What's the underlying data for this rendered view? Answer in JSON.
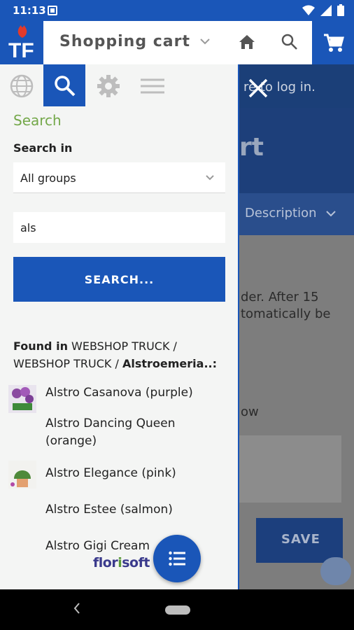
{
  "status_bar": {
    "time": "11:13"
  },
  "header": {
    "title": "Shopping cart"
  },
  "background_page": {
    "login_text": "re to log in.",
    "banner_text": "rt",
    "description_label": "Description",
    "text_line1": "der. After 15",
    "text_line2": "tomatically be",
    "text_line3": "ow",
    "save_label": "SAVE"
  },
  "drawer": {
    "section_title": "Search",
    "search_in_label": "Search in",
    "search_in_value": "All groups",
    "search_value": "als",
    "search_button": "SEARCH...",
    "found": {
      "prefix": "Found in",
      "path": "WEBSHOP TRUCK / WEBSHOP TRUCK /",
      "group": "Alstroemeria..:"
    },
    "results": [
      {
        "name": "Alstro Casanova (purple)",
        "has_thumb": true
      },
      {
        "name": "Alstro Dancing Queen (orange)",
        "has_thumb": false
      },
      {
        "name": "Alstro Elegance (pink)",
        "has_thumb": true
      },
      {
        "name": "Alstro Estee (salmon)",
        "has_thumb": false
      },
      {
        "name": "Alstro Gigi Cream",
        "has_thumb": false
      }
    ],
    "brand": {
      "part1": "flor",
      "part2": "i",
      "part3": "soft"
    }
  },
  "colors": {
    "primary": "#1a56b8",
    "accent_green": "#74a84a"
  }
}
